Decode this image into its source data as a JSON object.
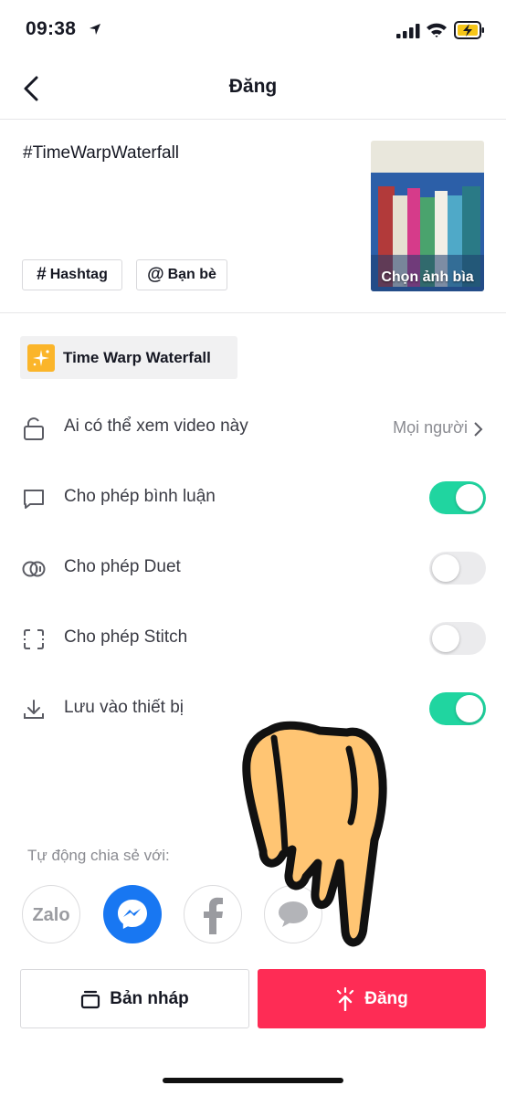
{
  "status_bar": {
    "time": "09:38"
  },
  "header": {
    "title": "Đăng"
  },
  "caption": {
    "text": "#TimeWarpWaterfall"
  },
  "tags": {
    "hashtag_label": "Hashtag",
    "mention_label": "Bạn bè"
  },
  "cover": {
    "label": "Chọn ảnh bìa"
  },
  "effect": {
    "label": "Time Warp Waterfall"
  },
  "settings": {
    "who_can_view": {
      "label": "Ai có thể xem video này",
      "value": "Mọi người"
    },
    "comments": {
      "label": "Cho phép bình luận",
      "enabled": true
    },
    "duet": {
      "label": "Cho phép Duet",
      "enabled": false
    },
    "stitch": {
      "label": "Cho phép Stitch",
      "enabled": false
    },
    "save": {
      "label": "Lưu vào thiết bị",
      "enabled": true
    }
  },
  "share": {
    "label": "Tự động chia sẻ với:",
    "targets": [
      {
        "name": "Zalo",
        "icon": "zalo-icon"
      },
      {
        "name": "Messenger",
        "icon": "messenger-icon"
      },
      {
        "name": "Facebook",
        "icon": "facebook-icon"
      },
      {
        "name": "Messages",
        "icon": "messages-icon"
      }
    ]
  },
  "actions": {
    "draft_label": "Bản nháp",
    "post_label": "Đăng"
  },
  "colors": {
    "accent": "#fe2c55",
    "toggle_on": "#20d5a0",
    "messenger": "#1877f2",
    "effect_icon": "#fbb52a"
  }
}
